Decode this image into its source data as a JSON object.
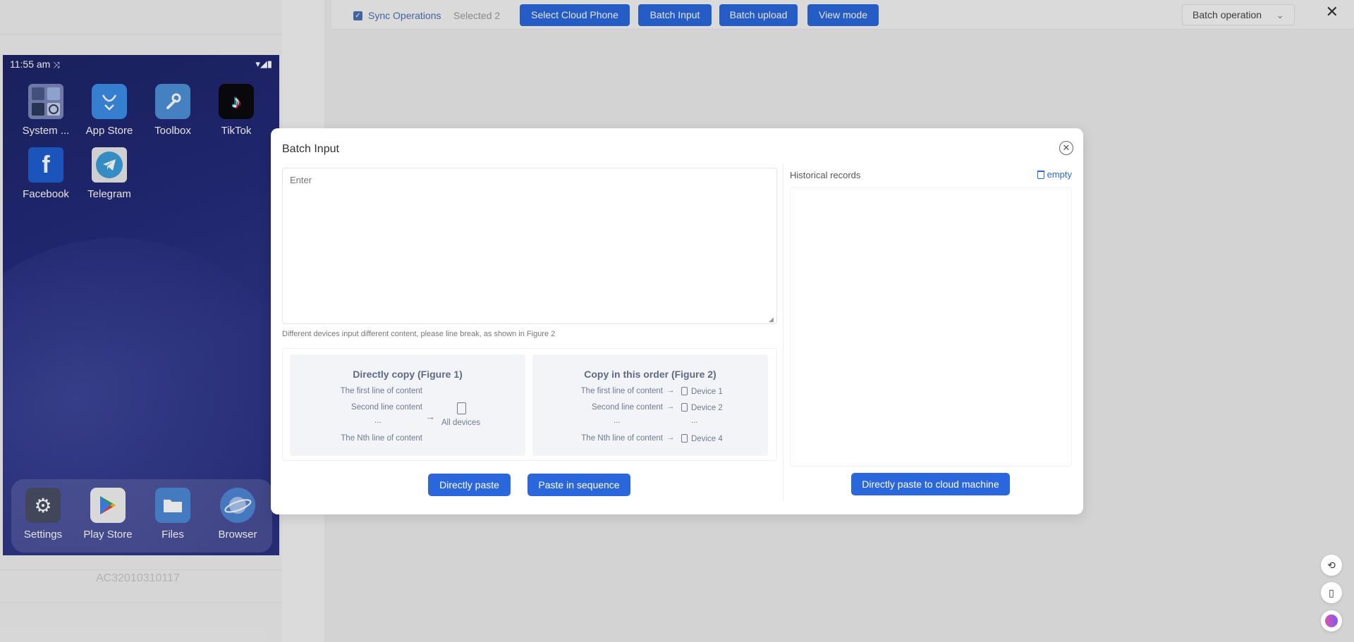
{
  "toolbar": {
    "sync_label": "Sync Operations",
    "selected_label": "Selected 2",
    "buttons": [
      {
        "label": "Select Cloud Phone"
      },
      {
        "label": "Batch Input"
      },
      {
        "label": "Batch upload"
      },
      {
        "label": "View mode"
      }
    ],
    "batch_operation": "Batch operation",
    "close": "✕"
  },
  "phone": {
    "time": "11:55 am",
    "device_id": "AC32010310117",
    "apps": [
      {
        "label": "System ...",
        "icon": "gallery-tools-icon"
      },
      {
        "label": "App Store",
        "icon": "app-store-icon"
      },
      {
        "label": "Toolbox",
        "icon": "wrench-icon"
      },
      {
        "label": "TikTok",
        "icon": "tiktok-icon"
      },
      {
        "label": "Facebook",
        "icon": "facebook-icon"
      },
      {
        "label": "Telegram",
        "icon": "telegram-icon"
      }
    ],
    "dock": [
      {
        "label": "Settings",
        "icon": "gear-icon"
      },
      {
        "label": "Play Store",
        "icon": "play-store-icon"
      },
      {
        "label": "Files",
        "icon": "folder-icon"
      },
      {
        "label": "Browser",
        "icon": "planet-icon"
      }
    ]
  },
  "modal": {
    "title": "Batch Input",
    "placeholder": "Enter",
    "hint": "Different devices input different content, please line break, as shown in Figure 2",
    "figure1": {
      "title": "Directly copy (Figure 1)",
      "lines": [
        "The first line of content",
        "Second line content",
        "...",
        "The Nth line of content"
      ],
      "target": "All devices"
    },
    "figure2": {
      "title": "Copy in this order (Figure 2)",
      "lines": [
        "The first line of content",
        "Second line content",
        "...",
        "The Nth line of content"
      ],
      "targets": [
        "Device 1",
        "Device 2",
        "...",
        "Device 4"
      ]
    },
    "paste_directly": "Directly paste",
    "paste_sequence": "Paste in sequence",
    "history_label": "Historical records",
    "history_empty": "empty",
    "paste_cloud": "Directly paste to cloud machine"
  },
  "colors": {
    "primary": "#2b67dc",
    "sync_blue": "#4b6fb0"
  }
}
